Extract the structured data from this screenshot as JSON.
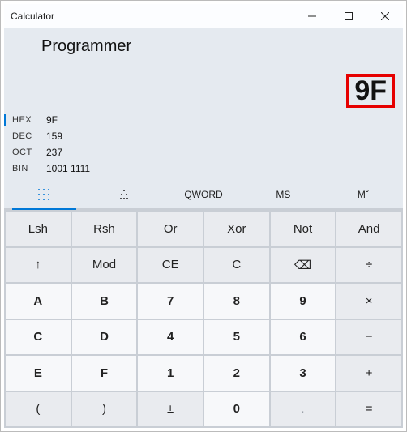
{
  "window": {
    "title": "Calculator"
  },
  "header": {
    "mode": "Programmer"
  },
  "result": {
    "value": "9F"
  },
  "bases": {
    "hex": {
      "label": "HEX",
      "value": "9F"
    },
    "dec": {
      "label": "DEC",
      "value": "159"
    },
    "oct": {
      "label": "OCT",
      "value": "237"
    },
    "bin": {
      "label": "BIN",
      "value": "1001 1111"
    }
  },
  "tools": {
    "qword": "QWORD",
    "ms": "MS",
    "mlist": "Mˇ"
  },
  "keys": {
    "lsh": "Lsh",
    "rsh": "Rsh",
    "or": "Or",
    "xor": "Xor",
    "not": "Not",
    "and": "And",
    "up": "↑",
    "mod": "Mod",
    "ce": "CE",
    "c": "C",
    "bsp": "⌫",
    "div": "÷",
    "a": "A",
    "b": "B",
    "k7": "7",
    "k8": "8",
    "k9": "9",
    "mul": "×",
    "cc": "C",
    "d": "D",
    "k4": "4",
    "k5": "5",
    "k6": "6",
    "sub": "−",
    "e": "E",
    "f": "F",
    "k1": "1",
    "k2": "2",
    "k3": "3",
    "add": "+",
    "lpar": "(",
    "rpar": ")",
    "pm": "±",
    "k0": "0",
    "dot": ".",
    "eq": "="
  }
}
